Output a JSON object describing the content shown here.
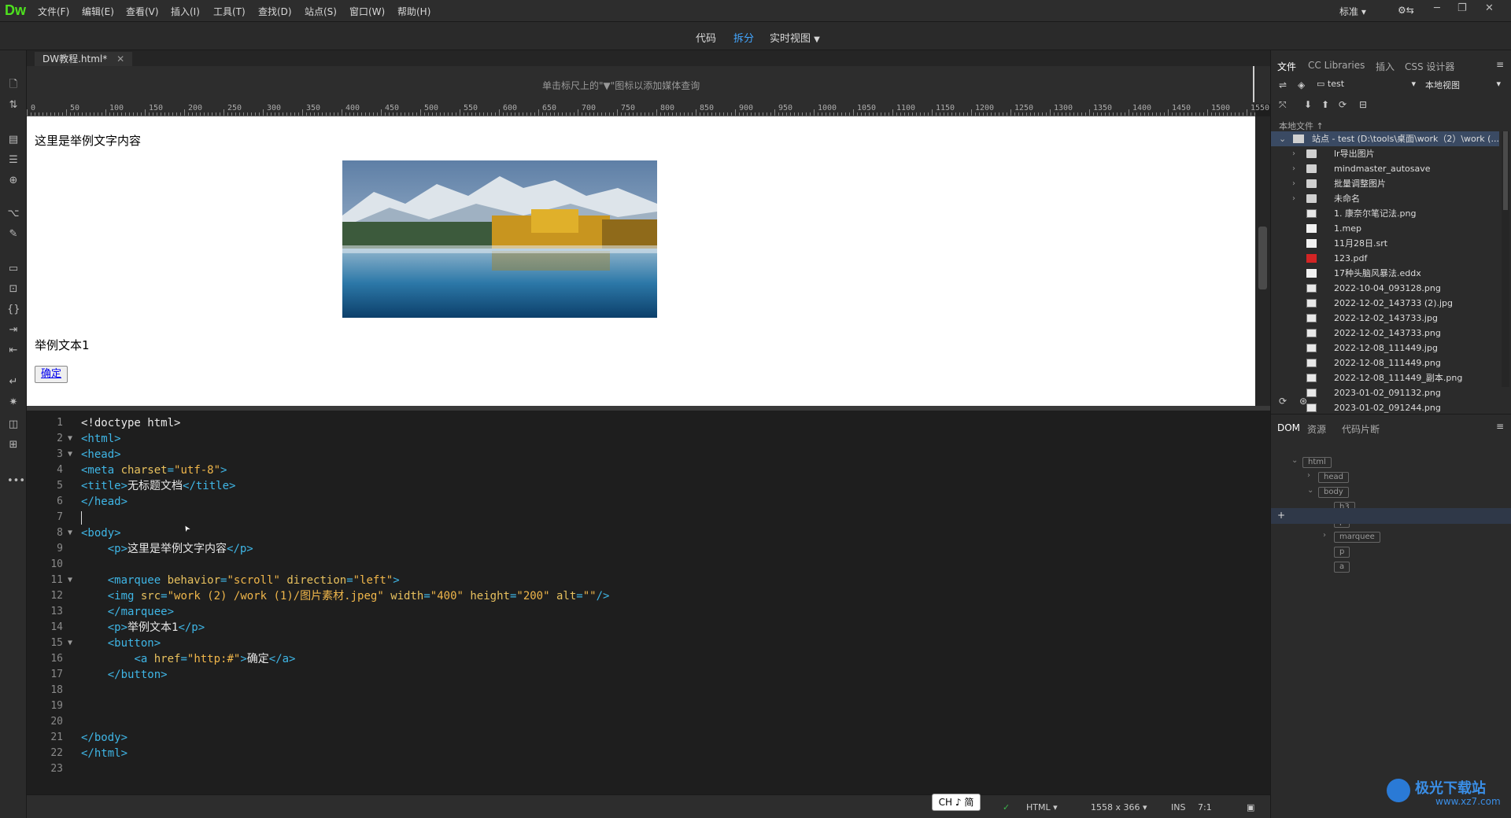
{
  "app": {
    "logo": "Dw"
  },
  "menu": [
    "文件(F)",
    "编辑(E)",
    "查看(V)",
    "插入(I)",
    "工具(T)",
    "查找(D)",
    "站点(S)",
    "窗口(W)",
    "帮助(H)"
  ],
  "workspace": {
    "label": "标准",
    "settings_icon": "gear-icon"
  },
  "view_switch": {
    "code": "代码",
    "split": "拆分",
    "live": "实时视图"
  },
  "document_tab": {
    "title": "DW教程.html*"
  },
  "media_query_hint": "单击标尺上的\"▼\"图标以添加媒体查询",
  "ruler_ticks": [
    "0",
    "50",
    "100",
    "150",
    "200",
    "250",
    "300",
    "350",
    "400",
    "450",
    "500",
    "550",
    "600",
    "650",
    "700",
    "750",
    "800",
    "850",
    "900",
    "950",
    "1000",
    "1050",
    "1100",
    "1150",
    "1200",
    "1250",
    "1300",
    "1350",
    "1400",
    "1450",
    "1500",
    "1550"
  ],
  "live_view": {
    "paragraph1": "这里是举例文字内容",
    "paragraph2": "举例文本1",
    "button_text": "确定"
  },
  "code_lines": [
    {
      "n": "1",
      "fold": "",
      "html": "<span class='txt'>&lt;!doctype html&gt;</span>"
    },
    {
      "n": "2",
      "fold": "▼",
      "html": "<span class='tag'>&lt;html&gt;</span>"
    },
    {
      "n": "3",
      "fold": "▼",
      "html": "<span class='tag'>&lt;head&gt;</span>"
    },
    {
      "n": "4",
      "fold": "",
      "html": "<span class='tag'>&lt;meta </span><span class='attr'>charset</span><span class='tag'>=</span><span class='aval'>\"utf-8\"</span><span class='tag'>&gt;</span>"
    },
    {
      "n": "5",
      "fold": "",
      "html": "<span class='tag'>&lt;title&gt;</span><span class='txt'>无标题文档</span><span class='tag'>&lt;/title&gt;</span>"
    },
    {
      "n": "6",
      "fold": "",
      "html": "<span class='tag'>&lt;/head&gt;</span>"
    },
    {
      "n": "7",
      "fold": "",
      "html": ""
    },
    {
      "n": "8",
      "fold": "▼",
      "html": "<span class='tag'>&lt;body&gt;</span>"
    },
    {
      "n": "9",
      "fold": "",
      "html": "    <span class='tag'>&lt;p&gt;</span><span class='txt'>这里是举例文字内容</span><span class='tag'>&lt;/p&gt;</span>"
    },
    {
      "n": "10",
      "fold": "",
      "html": ""
    },
    {
      "n": "11",
      "fold": "▼",
      "html": "    <span class='tag'>&lt;marquee </span><span class='attr'>behavior</span><span class='tag'>=</span><span class='aval'>\"scroll\"</span><span class='attr'> direction</span><span class='tag'>=</span><span class='aval'>\"left\"</span><span class='tag'>&gt;</span>"
    },
    {
      "n": "12",
      "fold": "",
      "html": "    <span class='tag'>&lt;img </span><span class='attr'>src</span><span class='tag'>=</span><span class='aval'>\"work (2) /work (1)/图片素材.jpeg\"</span><span class='attr'> width</span><span class='tag'>=</span><span class='aval'>\"400\"</span><span class='attr'> height</span><span class='tag'>=</span><span class='aval'>\"200\"</span><span class='attr'> alt</span><span class='tag'>=</span><span class='aval'>\"\"</span><span class='tag'>/&gt;</span>"
    },
    {
      "n": "13",
      "fold": "",
      "html": "    <span class='tag'>&lt;/marquee&gt;</span>"
    },
    {
      "n": "14",
      "fold": "",
      "html": "    <span class='tag'>&lt;p&gt;</span><span class='txt'>举例文本1</span><span class='tag'>&lt;/p&gt;</span>"
    },
    {
      "n": "15",
      "fold": "▼",
      "html": "    <span class='tag'>&lt;button&gt;</span>"
    },
    {
      "n": "16",
      "fold": "",
      "html": "        <span class='tag'>&lt;a </span><span class='attr'>href</span><span class='tag'>=</span><span class='aval'>\"http:#\"</span><span class='tag'>&gt;</span><span class='txt'>确定</span><span class='tag'>&lt;/a&gt;</span>"
    },
    {
      "n": "17",
      "fold": "",
      "html": "    <span class='tag'>&lt;/button&gt;</span>"
    },
    {
      "n": "18",
      "fold": "",
      "html": ""
    },
    {
      "n": "19",
      "fold": "",
      "html": ""
    },
    {
      "n": "20",
      "fold": "",
      "html": ""
    },
    {
      "n": "21",
      "fold": "",
      "html": "<span class='tag'>&lt;/body&gt;</span>"
    },
    {
      "n": "22",
      "fold": "",
      "html": "<span class='tag'>&lt;/html&gt;</span>"
    },
    {
      "n": "23",
      "fold": "",
      "html": ""
    }
  ],
  "status_bar": {
    "ime": "CH ♪ 简",
    "doc_type": "HTML",
    "size": "1558 x 366",
    "ins": "INS",
    "position": "7:1"
  },
  "files_panel": {
    "tabs": [
      "文件",
      "CC Libraries",
      "插入",
      "CSS 设计器"
    ],
    "site_select": "test",
    "view_select": "本地视图",
    "local_files_label": "本地文件 ↑",
    "site_root": "站点 - test (D:\\tools\\桌面\\work（2）\\work (...",
    "items": [
      {
        "name": "lr导出图片",
        "type": "folder"
      },
      {
        "name": "mindmaster_autosave",
        "type": "folder"
      },
      {
        "name": "批量调整图片",
        "type": "folder"
      },
      {
        "name": "未命名",
        "type": "folder"
      },
      {
        "name": "1. 康奈尔笔记法.png",
        "type": "image"
      },
      {
        "name": "1.mep",
        "type": "file"
      },
      {
        "name": "11月28日.srt",
        "type": "file"
      },
      {
        "name": "123.pdf",
        "type": "pdf"
      },
      {
        "name": "17种头脑风暴法.eddx",
        "type": "file"
      },
      {
        "name": "2022-10-04_093128.png",
        "type": "image"
      },
      {
        "name": "2022-12-02_143733 (2).jpg",
        "type": "image"
      },
      {
        "name": "2022-12-02_143733.jpg",
        "type": "image"
      },
      {
        "name": "2022-12-02_143733.png",
        "type": "image"
      },
      {
        "name": "2022-12-08_111449.jpg",
        "type": "image"
      },
      {
        "name": "2022-12-08_111449.png",
        "type": "image"
      },
      {
        "name": "2022-12-08_111449_副本.png",
        "type": "image"
      },
      {
        "name": "2023-01-02_091132.png",
        "type": "image"
      },
      {
        "name": "2023-01-02_091244.png",
        "type": "image"
      }
    ]
  },
  "dom_panel": {
    "tabs": [
      "DOM",
      "资源",
      "代码片断"
    ],
    "nodes": [
      "html",
      "head",
      "body",
      "h3",
      "p",
      "marquee",
      "p",
      "a"
    ]
  },
  "watermark": {
    "site_name": "极光下载站",
    "url": "www.xz7.com"
  }
}
